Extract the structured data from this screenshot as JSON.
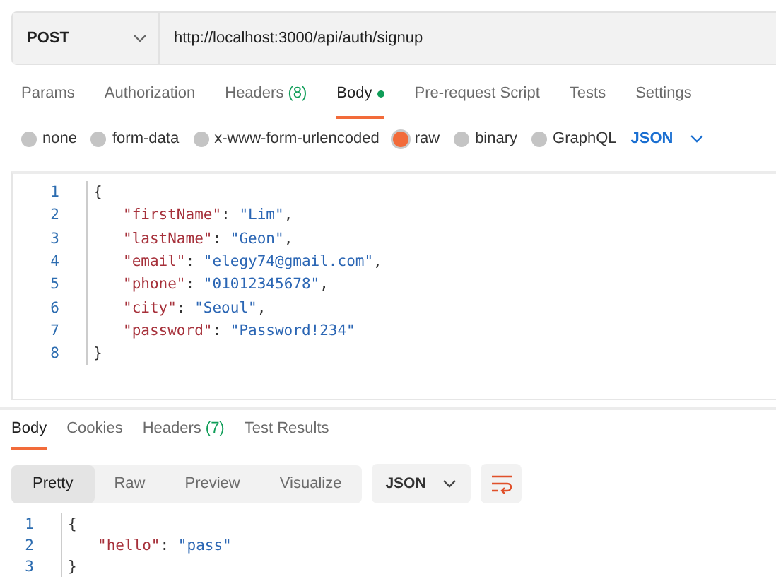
{
  "request": {
    "method": "POST",
    "url": "http://localhost:3000/api/auth/signup"
  },
  "request_tabs": [
    {
      "label": "Params",
      "dot": false,
      "selected": false
    },
    {
      "label": "Authorization",
      "dot": false,
      "selected": false
    },
    {
      "label": "Headers",
      "count": "(8)",
      "dot": false,
      "selected": false
    },
    {
      "label": "Body",
      "dot": true,
      "selected": true
    },
    {
      "label": "Pre-request Script",
      "dot": false,
      "selected": false
    },
    {
      "label": "Tests",
      "dot": false,
      "selected": false
    },
    {
      "label": "Settings",
      "dot": false,
      "selected": false
    }
  ],
  "body_types": [
    {
      "label": "none",
      "selected": false
    },
    {
      "label": "form-data",
      "selected": false
    },
    {
      "label": "x-www-form-urlencoded",
      "selected": false
    },
    {
      "label": "raw",
      "selected": true
    },
    {
      "label": "binary",
      "selected": false
    },
    {
      "label": "GraphQL",
      "selected": false
    }
  ],
  "body_format": "JSON",
  "request_body": [
    {
      "number": "1",
      "tokens": [
        {
          "kind": "punct",
          "text": "{"
        }
      ]
    },
    {
      "number": "2",
      "tokens": [
        {
          "kind": "key",
          "text": "\"firstName\""
        },
        {
          "kind": "punct",
          "text": ": "
        },
        {
          "kind": "string",
          "text": "\"Lim\""
        },
        {
          "kind": "punct",
          "text": ","
        }
      ]
    },
    {
      "number": "3",
      "tokens": [
        {
          "kind": "key",
          "text": "\"lastName\""
        },
        {
          "kind": "punct",
          "text": ": "
        },
        {
          "kind": "string",
          "text": "\"Geon\""
        },
        {
          "kind": "punct",
          "text": ","
        }
      ]
    },
    {
      "number": "4",
      "tokens": [
        {
          "kind": "key",
          "text": "\"email\""
        },
        {
          "kind": "punct",
          "text": ": "
        },
        {
          "kind": "string",
          "text": "\"elegy74@gmail.com\""
        },
        {
          "kind": "punct",
          "text": ","
        }
      ]
    },
    {
      "number": "5",
      "tokens": [
        {
          "kind": "key",
          "text": "\"phone\""
        },
        {
          "kind": "punct",
          "text": ": "
        },
        {
          "kind": "string",
          "text": "\"01012345678\""
        },
        {
          "kind": "punct",
          "text": ","
        }
      ]
    },
    {
      "number": "6",
      "tokens": [
        {
          "kind": "key",
          "text": "\"city\""
        },
        {
          "kind": "punct",
          "text": ": "
        },
        {
          "kind": "string",
          "text": "\"Seoul\""
        },
        {
          "kind": "punct",
          "text": ","
        }
      ]
    },
    {
      "number": "7",
      "tokens": [
        {
          "kind": "key",
          "text": "\"password\""
        },
        {
          "kind": "punct",
          "text": ": "
        },
        {
          "kind": "string",
          "text": "\"Password!234\""
        }
      ]
    },
    {
      "number": "8",
      "tokens": [
        {
          "kind": "punct",
          "text": "}"
        }
      ]
    }
  ],
  "response_tabs": [
    {
      "label": "Body",
      "selected": true
    },
    {
      "label": "Cookies",
      "selected": false
    },
    {
      "label": "Headers",
      "count": "(7)",
      "selected": false
    },
    {
      "label": "Test Results",
      "selected": false
    }
  ],
  "view_modes": [
    {
      "label": "Pretty",
      "selected": true
    },
    {
      "label": "Raw",
      "selected": false
    },
    {
      "label": "Preview",
      "selected": false
    },
    {
      "label": "Visualize",
      "selected": false
    }
  ],
  "response_format": "JSON",
  "response_body": [
    {
      "number": "1",
      "tokens": [
        {
          "kind": "punct",
          "text": "{"
        }
      ]
    },
    {
      "number": "2",
      "tokens": [
        {
          "kind": "key",
          "text": "\"hello\""
        },
        {
          "kind": "punct",
          "text": ": "
        },
        {
          "kind": "string",
          "text": "\"pass\""
        }
      ]
    },
    {
      "number": "3",
      "tokens": [
        {
          "kind": "punct",
          "text": "}"
        }
      ]
    }
  ]
}
